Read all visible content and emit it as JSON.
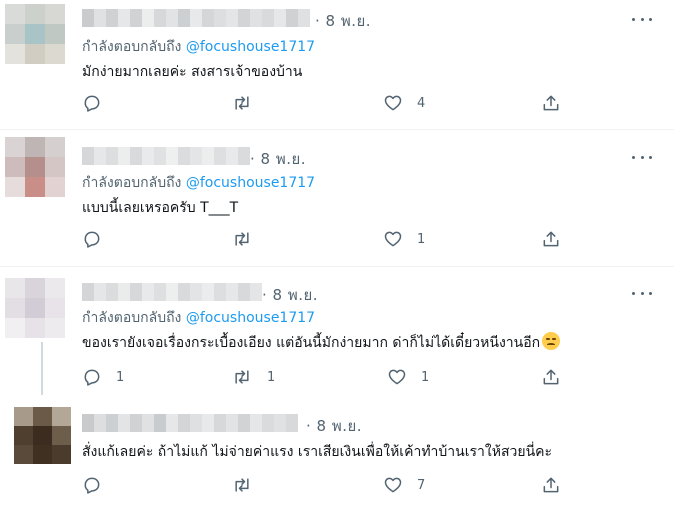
{
  "tweets": [
    {
      "date": "· 8 พ.ย.",
      "replying_label": "กำลังตอบกลับถึง",
      "replying_handle": "@focushouse1717",
      "text": "มักง่ายมากเลยค่ะ สงสารเจ้าของบ้าน",
      "reply_count": "",
      "retweet_count": "",
      "like_count": "4"
    },
    {
      "date": "· 8 พ.ย.",
      "replying_label": "กำลังตอบกลับถึง",
      "replying_handle": "@focushouse1717",
      "text": "แบบนี้เลยเหรอครับ T___T",
      "reply_count": "",
      "retweet_count": "",
      "like_count": "1"
    },
    {
      "date": "· 8 พ.ย.",
      "replying_label": "กำลังตอบกลับถึง",
      "replying_handle": "@focushouse1717",
      "text": "ของเรายังเจอเรื่องกระเบื้องเอียง แต่อันนี้มักง่ายมาก ด่าก็ไม่ได้เดี๋ยวหนีงานอีก",
      "emoji": "disappointed-face-emoji",
      "reply_count": "1",
      "retweet_count": "1",
      "like_count": "1"
    },
    {
      "date": "· 8 พ.ย.",
      "text": "สั่งแก้เลยค่ะ ถ้าไม่แก้ ไม่จ่ายค่าแรง เราเสียเงินเพื่อให้เค้าทำบ้านเราให้สวยนี่คะ",
      "reply_count": "",
      "retweet_count": "",
      "like_count": "7"
    }
  ],
  "icons": {
    "reply": "reply-icon",
    "retweet": "retweet-icon",
    "like": "heart-icon",
    "share": "share-icon",
    "more": "more-icon"
  },
  "colors": {
    "link": "#1d9bf0",
    "secondary_text": "#536471",
    "divider": "#eff3f4"
  }
}
